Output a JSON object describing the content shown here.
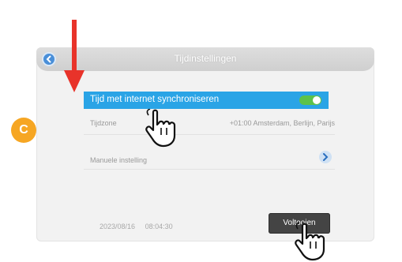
{
  "window": {
    "title": "Tijdinstellingen"
  },
  "settings": {
    "sync_label": "Tijd met internet synchroniseren",
    "sync_enabled": true,
    "timezone_label": "Tijdzone",
    "timezone_value": "+01:00 Amsterdam, Berlijn, Parijs",
    "manual_label": "Manuele instelling"
  },
  "footer": {
    "date": "2023/08/16",
    "time": "08:04:30",
    "done_label": "Voltooien"
  },
  "annotation": {
    "callout_letter": "C"
  },
  "colors": {
    "accent_blue": "#2aa4e6",
    "toggle_green": "#5cc24a",
    "arrow_red": "#e8332a",
    "callout_orange": "#f6a623"
  },
  "icons": {
    "back": "chevron-left-icon",
    "forward": "chevron-right-icon",
    "pointer": "hand-pointer-icon",
    "indicator": "arrow-down-icon"
  }
}
